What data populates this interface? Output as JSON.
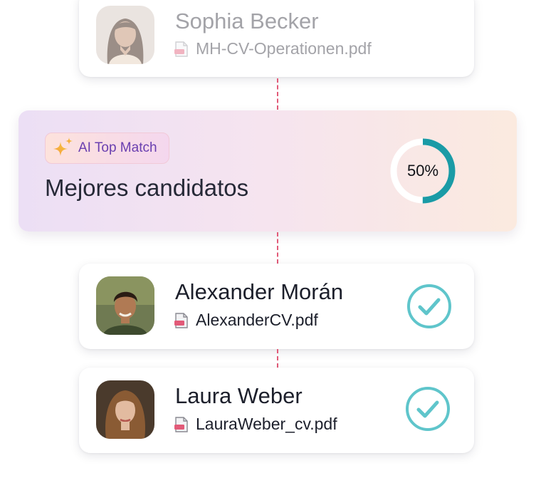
{
  "colors": {
    "accent_teal": "#1a9ba6",
    "check_teal": "#5fc5cb",
    "connector_pink": "#e25a78",
    "badge_text": "#6a3fb0"
  },
  "top_candidate": {
    "name": "Sophia Becker",
    "file": "MH-CV-Operationen.pdf",
    "avatar_icon": "person-photo-woman-dark-hair",
    "file_icon": "pdf-file-icon"
  },
  "match_panel": {
    "badge_icon": "sparkles-icon",
    "badge_label": "AI Top Match",
    "title": "Mejores candidatos",
    "progress_value": 0.5,
    "progress_label": "50%"
  },
  "candidates": [
    {
      "name": "Alexander Morán",
      "file": "AlexanderCV.pdf",
      "avatar_icon": "person-photo-man",
      "file_icon": "pdf-file-icon",
      "status_icon": "check-circle-icon"
    },
    {
      "name": "Laura Weber",
      "file": "LauraWeber_cv.pdf",
      "avatar_icon": "person-photo-woman-light-hair",
      "file_icon": "pdf-file-icon",
      "status_icon": "check-circle-icon"
    }
  ]
}
